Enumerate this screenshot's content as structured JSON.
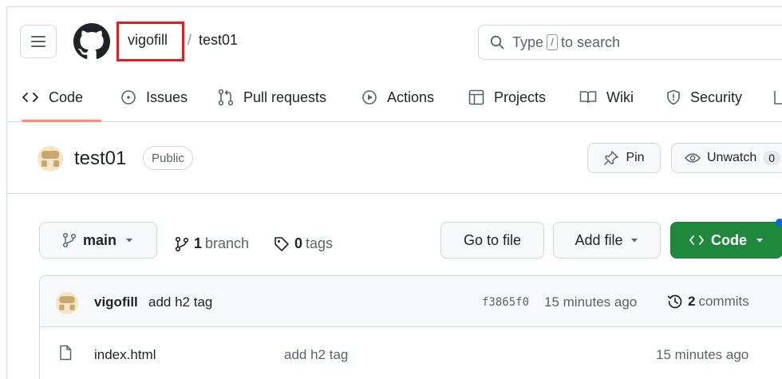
{
  "header": {
    "owner": "vigofill",
    "separator": "/",
    "repo": "test01",
    "search_prefix": "Type",
    "search_key": "/",
    "search_suffix": "to search"
  },
  "tabs": [
    {
      "label": "Code",
      "icon": "code-icon"
    },
    {
      "label": "Issues",
      "icon": "issue-icon"
    },
    {
      "label": "Pull requests",
      "icon": "pull-request-icon"
    },
    {
      "label": "Actions",
      "icon": "play-icon"
    },
    {
      "label": "Projects",
      "icon": "table-icon"
    },
    {
      "label": "Wiki",
      "icon": "book-icon"
    },
    {
      "label": "Security",
      "icon": "shield-icon"
    }
  ],
  "repo_bar": {
    "title": "test01",
    "visibility": "Public",
    "pin_label": "Pin",
    "unwatch_label": "Unwatch",
    "watch_count": "0"
  },
  "toolbar": {
    "branch": "main",
    "branch_count": "1",
    "branch_word": "branch",
    "tag_count": "0",
    "tag_word": "tags",
    "goto_label": "Go to file",
    "add_label": "Add file",
    "code_label": "Code"
  },
  "latest_commit": {
    "author": "vigofill",
    "message": "add h2 tag",
    "sha": "f3865f0",
    "time": "15 minutes ago",
    "commit_count": "2",
    "commit_word": "commits"
  },
  "files": [
    {
      "name": "index.html",
      "message": "add h2 tag",
      "time": "15 minutes ago"
    }
  ],
  "colors": {
    "accent_green": "#1f883d",
    "highlight_box": "#e31b23",
    "tab_underline": "#fd8c73"
  }
}
